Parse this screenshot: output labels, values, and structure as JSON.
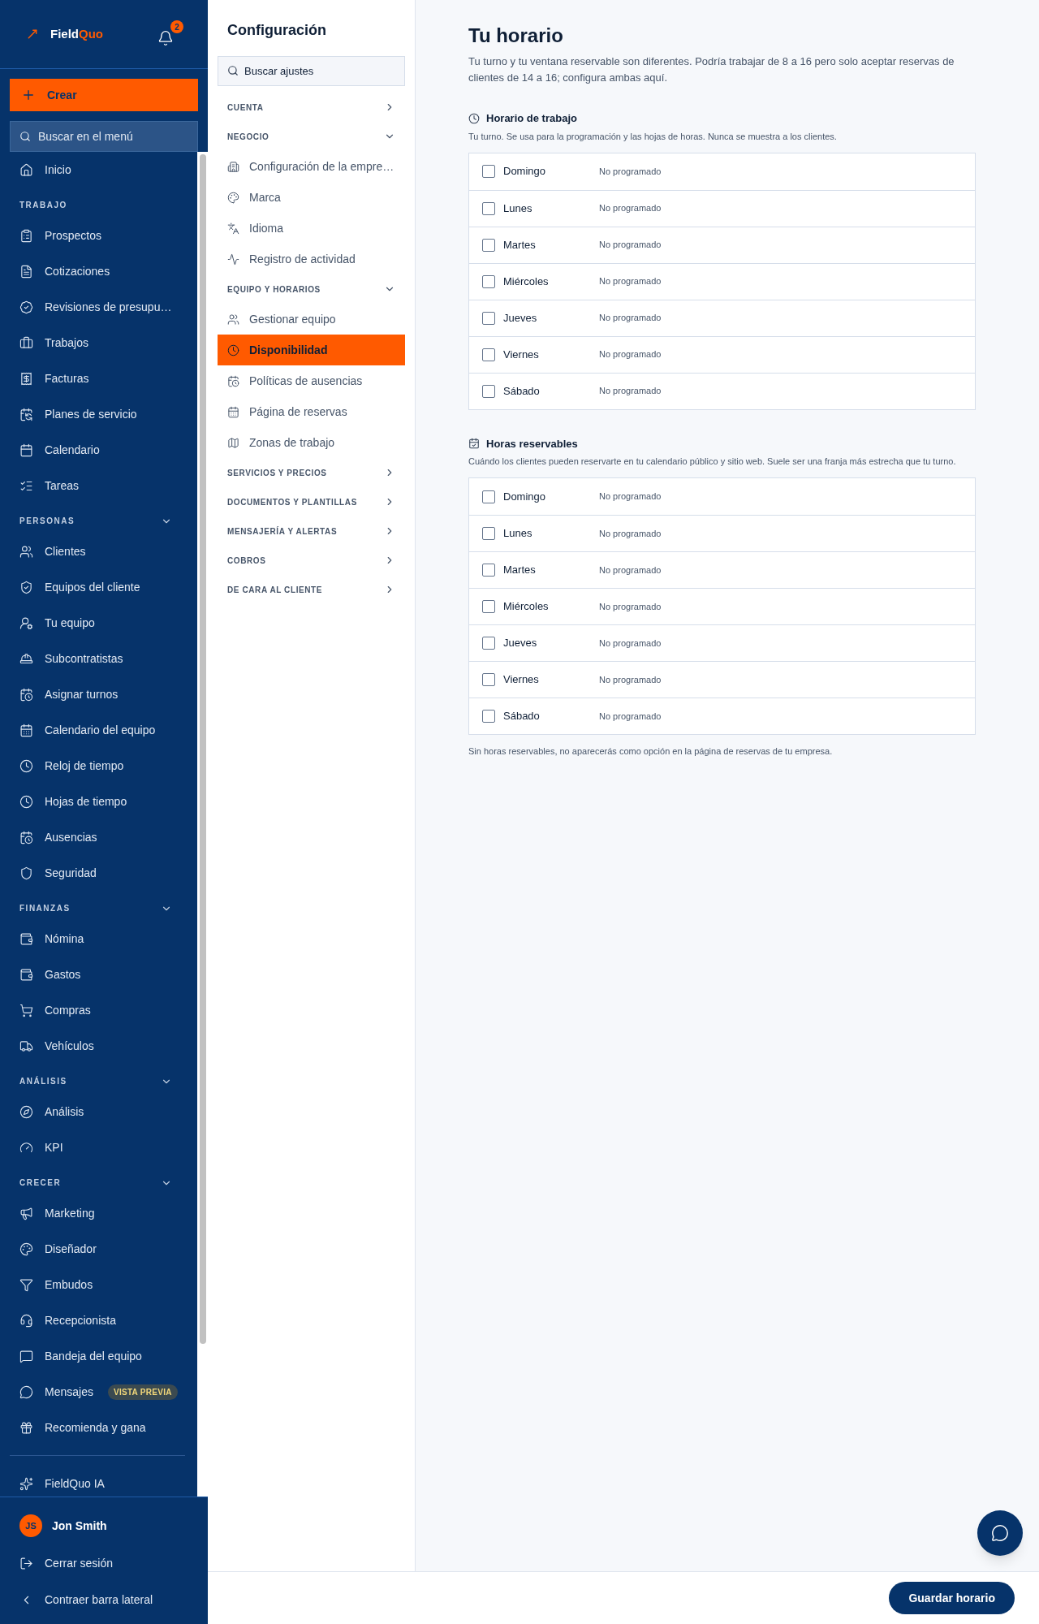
{
  "sidebar": {
    "logo": {
      "text": "Field",
      "accent": "Quo"
    },
    "notifications": {
      "count": "2"
    },
    "create_button": "Crear",
    "search": {
      "placeholder": "Buscar en el menú"
    },
    "nav": [
      {
        "kind": "item",
        "label": "Inicio"
      },
      {
        "kind": "section",
        "label": "TRABAJO",
        "collapsible": false
      },
      {
        "kind": "item",
        "label": "Prospectos"
      },
      {
        "kind": "item",
        "label": "Cotizaciones"
      },
      {
        "kind": "item",
        "label": "Revisiones de presupu…"
      },
      {
        "kind": "item",
        "label": "Trabajos"
      },
      {
        "kind": "item",
        "label": "Facturas"
      },
      {
        "kind": "item",
        "label": "Planes de servicio"
      },
      {
        "kind": "item",
        "label": "Calendario"
      },
      {
        "kind": "item",
        "label": "Tareas"
      },
      {
        "kind": "section",
        "label": "PERSONAS",
        "collapsible": true
      },
      {
        "kind": "item",
        "label": "Clientes"
      },
      {
        "kind": "item",
        "label": "Equipos del cliente"
      },
      {
        "kind": "item",
        "label": "Tu equipo"
      },
      {
        "kind": "item",
        "label": "Subcontratistas"
      },
      {
        "kind": "item",
        "label": "Asignar turnos"
      },
      {
        "kind": "item",
        "label": "Calendario del equipo"
      },
      {
        "kind": "item",
        "label": "Reloj de tiempo"
      },
      {
        "kind": "item",
        "label": "Hojas de tiempo"
      },
      {
        "kind": "item",
        "label": "Ausencias"
      },
      {
        "kind": "item",
        "label": "Seguridad"
      },
      {
        "kind": "section",
        "label": "FINANZAS",
        "collapsible": true
      },
      {
        "kind": "item",
        "label": "Nómina"
      },
      {
        "kind": "item",
        "label": "Gastos"
      },
      {
        "kind": "item",
        "label": "Compras"
      },
      {
        "kind": "item",
        "label": "Vehículos"
      },
      {
        "kind": "section",
        "label": "ANÁLISIS",
        "collapsible": true
      },
      {
        "kind": "item",
        "label": "Análisis"
      },
      {
        "kind": "item",
        "label": "KPI"
      },
      {
        "kind": "section",
        "label": "CRECER",
        "collapsible": true
      },
      {
        "kind": "item",
        "label": "Marketing"
      },
      {
        "kind": "item",
        "label": "Diseñador"
      },
      {
        "kind": "item",
        "label": "Embudos"
      },
      {
        "kind": "item",
        "label": "Recepcionista"
      },
      {
        "kind": "item",
        "label": "Bandeja del equipo"
      },
      {
        "kind": "item",
        "label": "Mensajes",
        "badge": "VISTA PREVIA"
      },
      {
        "kind": "item",
        "label": "Recomienda y gana"
      },
      {
        "kind": "divider"
      },
      {
        "kind": "item",
        "label": "FieldQuo IA"
      }
    ],
    "user": {
      "initials": "JS",
      "name": "Jon Smith"
    },
    "logout": "Cerrar sesión",
    "collapse": "Contraer barra lateral"
  },
  "settings": {
    "title": "Configuración",
    "search": {
      "placeholder": "Buscar ajustes"
    },
    "groups": [
      {
        "label": "CUENTA",
        "expanded": false
      },
      {
        "label": "NEGOCIO",
        "expanded": true,
        "items": [
          {
            "label": "Configuración de la empre…",
            "selected": false
          },
          {
            "label": "Marca",
            "selected": false
          },
          {
            "label": "Idioma",
            "selected": false
          },
          {
            "label": "Registro de actividad",
            "selected": false
          }
        ]
      },
      {
        "label": "EQUIPO Y HORARIOS",
        "expanded": true,
        "items": [
          {
            "label": "Gestionar equipo",
            "selected": false
          },
          {
            "label": "Disponibilidad",
            "selected": true
          },
          {
            "label": "Políticas de ausencias",
            "selected": false
          },
          {
            "label": "Página de reservas",
            "selected": false
          },
          {
            "label": "Zonas de trabajo",
            "selected": false
          }
        ]
      },
      {
        "label": "SERVICIOS Y PRECIOS",
        "expanded": false
      },
      {
        "label": "DOCUMENTOS Y PLANTILLAS",
        "expanded": false
      },
      {
        "label": "MENSAJERÍA Y ALERTAS",
        "expanded": false
      },
      {
        "label": "COBROS",
        "expanded": false
      },
      {
        "label": "DE CARA AL CLIENTE",
        "expanded": false
      }
    ]
  },
  "main": {
    "title": "Tu horario",
    "intro": "Tu turno y tu ventana reservable son diferentes. Podría trabajar de 8 a 16 pero solo aceptar reservas de clientes de 14 a 16; configura ambas aquí.",
    "sections": [
      {
        "title": "Horario de trabajo",
        "description": "Tu turno. Se usa para la programación y las hojas de horas. Nunca se muestra a los clientes.",
        "days": [
          {
            "label": "Domingo",
            "checked": false,
            "status": "No programado"
          },
          {
            "label": "Lunes",
            "checked": false,
            "status": "No programado"
          },
          {
            "label": "Martes",
            "checked": false,
            "status": "No programado"
          },
          {
            "label": "Miércoles",
            "checked": false,
            "status": "No programado"
          },
          {
            "label": "Jueves",
            "checked": false,
            "status": "No programado"
          },
          {
            "label": "Viernes",
            "checked": false,
            "status": "No programado"
          },
          {
            "label": "Sábado",
            "checked": false,
            "status": "No programado"
          }
        ]
      },
      {
        "title": "Horas reservables",
        "description": "Cuándo los clientes pueden reservarte en tu calendario público y sitio web. Suele ser una franja más estrecha que tu turno.",
        "days": [
          {
            "label": "Domingo",
            "checked": false,
            "status": "No programado"
          },
          {
            "label": "Lunes",
            "checked": false,
            "status": "No programado"
          },
          {
            "label": "Martes",
            "checked": false,
            "status": "No programado"
          },
          {
            "label": "Miércoles",
            "checked": false,
            "status": "No programado"
          },
          {
            "label": "Jueves",
            "checked": false,
            "status": "No programado"
          },
          {
            "label": "Viernes",
            "checked": false,
            "status": "No programado"
          },
          {
            "label": "Sábado",
            "checked": false,
            "status": "No programado"
          }
        ],
        "note": "Sin horas reservables, no aparecerás como opción en la página de reservas de tu empresa."
      }
    ]
  },
  "footer": {
    "save_button": "Guardar horario"
  }
}
